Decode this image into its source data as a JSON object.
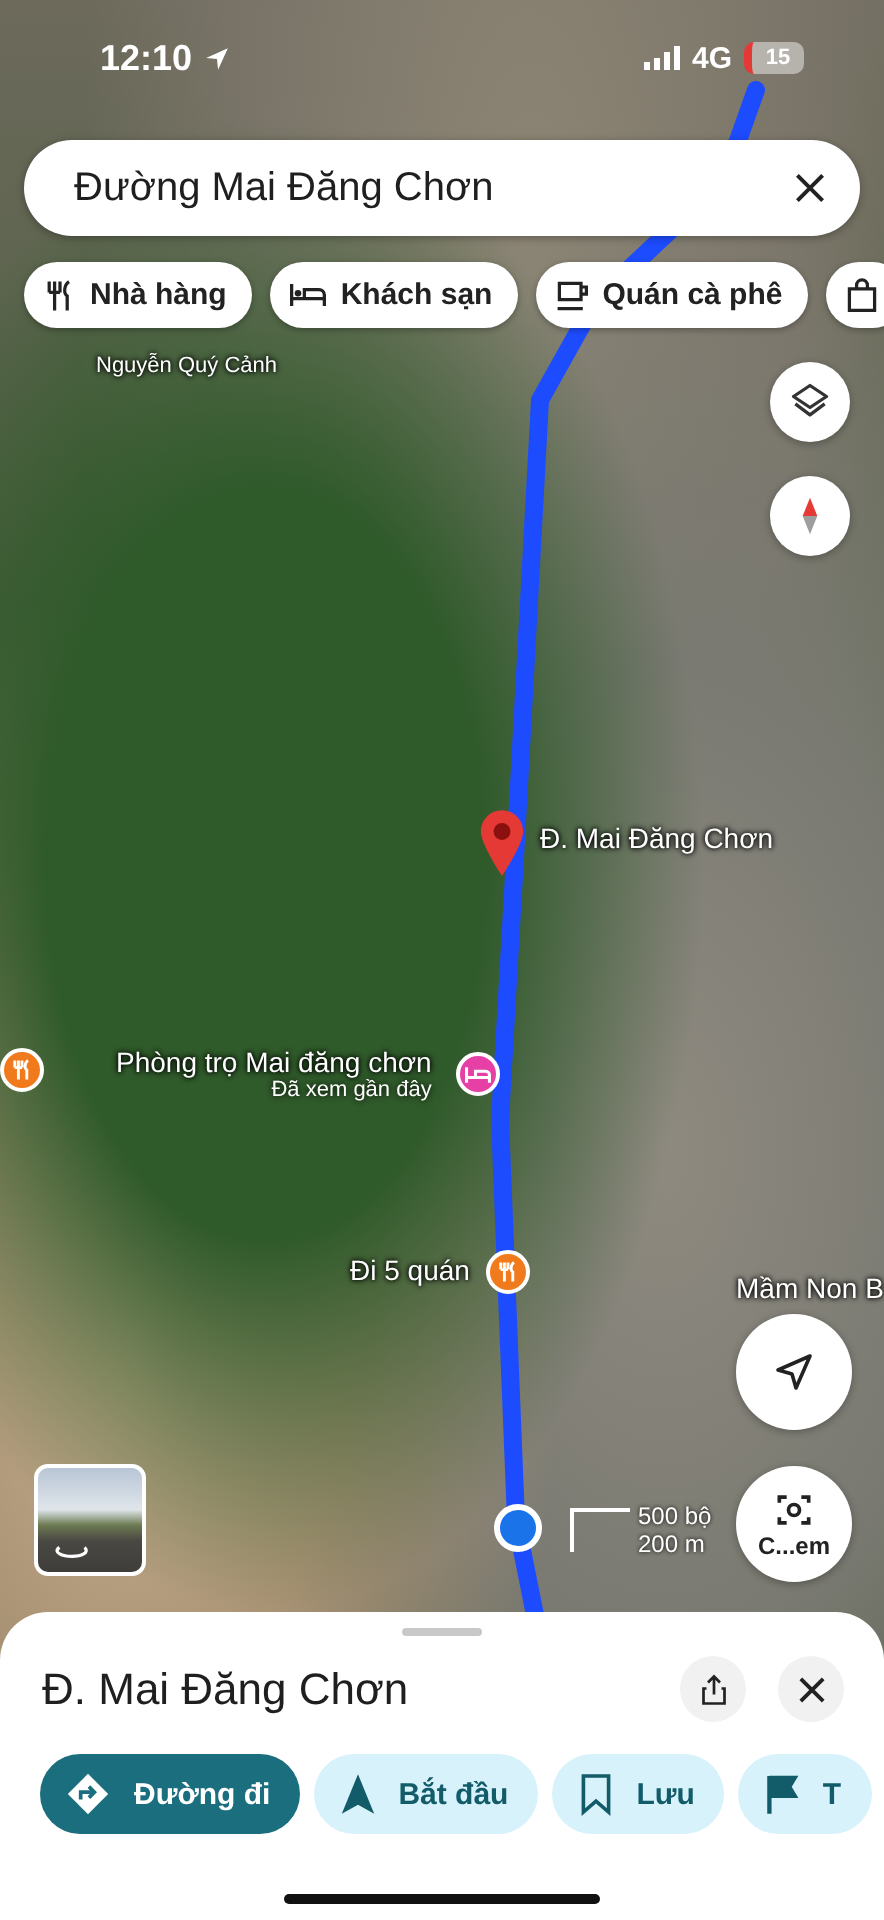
{
  "status_bar": {
    "time": "12:10",
    "network": "4G",
    "battery": "15"
  },
  "search": {
    "value": "Đường Mai Đăng Chơn"
  },
  "chips": [
    {
      "label": "Nhà hàng",
      "kind": "restaurant"
    },
    {
      "label": "Khách sạn",
      "kind": "hotel"
    },
    {
      "label": "Quán cà phê",
      "kind": "cafe"
    },
    {
      "kind": "shopping"
    }
  ],
  "map": {
    "labels": [
      {
        "text": "Nguyễn Quý Cảnh",
        "kind": "street"
      },
      {
        "text": "Đ. Mai Đăng Chơn",
        "kind": "pin"
      },
      {
        "text": "Phòng trọ Mai đăng chơn",
        "note": "Đã xem gần đây",
        "kind": "hotel"
      },
      {
        "text": "Đi 5 quán",
        "kind": "restaurant"
      },
      {
        "text": "Mầm Non B",
        "kind": "plain"
      }
    ],
    "scale": [
      "500 bộ",
      "200 m"
    ],
    "camera_button": "C...em"
  },
  "sheet": {
    "title": "Đ. Mai Đăng Chơn",
    "actions": [
      {
        "label": "Đường đi",
        "kind": "primary"
      },
      {
        "label": "Bắt đầu",
        "kind": "start"
      },
      {
        "label": "Lưu",
        "kind": "save"
      },
      {
        "label": "T",
        "kind": "flag"
      }
    ]
  }
}
